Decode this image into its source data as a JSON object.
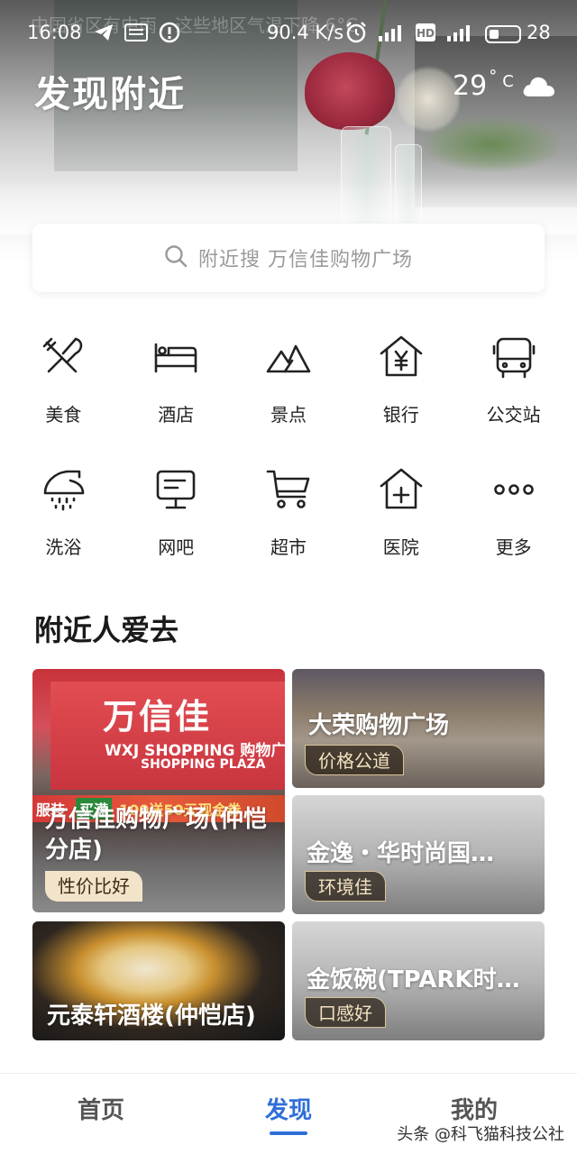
{
  "status_bar": {
    "time": "16:08",
    "notification_ghost": "中国省区有中雨，这些地区气温下降 6°C",
    "network_speed": "90.4 K/s",
    "battery_level": "28"
  },
  "header": {
    "title": "发现附近",
    "weather": {
      "temperature": "29",
      "degree_symbol": "°",
      "unit": "C",
      "icon": "cloud-icon"
    }
  },
  "search": {
    "placeholder": "附近搜 万信佳购物广场",
    "icon": "search-icon"
  },
  "categories": [
    {
      "label": "美食",
      "icon": "food-icon"
    },
    {
      "label": "酒店",
      "icon": "hotel-bed-icon"
    },
    {
      "label": "景点",
      "icon": "mountain-icon"
    },
    {
      "label": "银行",
      "icon": "bank-yen-icon"
    },
    {
      "label": "公交站",
      "icon": "bus-icon"
    },
    {
      "label": "洗浴",
      "icon": "shower-icon"
    },
    {
      "label": "网吧",
      "icon": "monitor-icon"
    },
    {
      "label": "超市",
      "icon": "cart-icon"
    },
    {
      "label": "医院",
      "icon": "hospital-icon"
    },
    {
      "label": "更多",
      "icon": "more-dots-icon"
    }
  ],
  "nearby": {
    "title": "附近人爱去",
    "cards": [
      {
        "name": "万信佳购物广场(仲恺分店)",
        "tag": "性价比好",
        "sign_text": "万信佳",
        "sign_sub": "WXJ SHOPPING",
        "sign_sub_cn": "购物广场",
        "sign_sub2": "SHOPPING PLAZA",
        "banner_left": "服装",
        "banner_mid": "买满",
        "banner_right": "100送50元现金券"
      },
      {
        "name": "大荣购物广场",
        "tag": "价格公道"
      },
      {
        "name": "金逸・华时尚国…",
        "tag": "环境佳"
      },
      {
        "name": "元泰轩酒楼(仲恺店)",
        "tag": ""
      },
      {
        "name": "金饭碗(TPARK时…",
        "tag": "口感好"
      }
    ]
  },
  "bottom_nav": {
    "items": [
      {
        "label": "首页",
        "active": false
      },
      {
        "label": "发现",
        "active": true
      },
      {
        "label": "我的",
        "active": false
      }
    ],
    "accent_color": "#2f6fd8"
  },
  "watermark": "头条 @科飞猫科技公社"
}
